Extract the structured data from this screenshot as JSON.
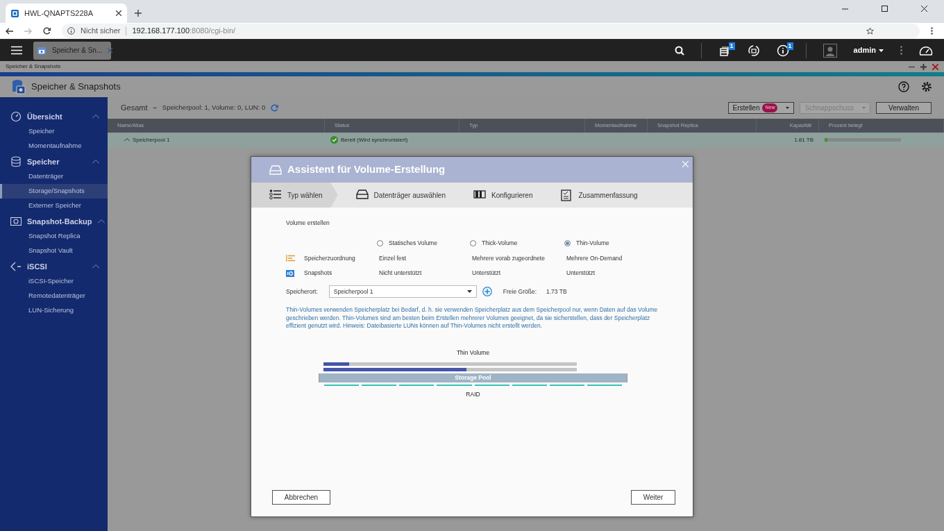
{
  "browser": {
    "tab_title": "HWL-QNAPTS228A",
    "security": "Nicht sicher",
    "url_host": "192.168.177.100",
    "url_rest": ":8080/cgi-bin/"
  },
  "app_bar": {
    "app_tab": "Speicher & Sn...",
    "toolbar_icons": [
      {
        "kind": "tasks",
        "badge": "1"
      },
      {
        "kind": "sync"
      },
      {
        "kind": "info",
        "badge": "1"
      }
    ],
    "user": "admin"
  },
  "window": {
    "caption": "Speicher & Snapshots",
    "title": "Speicher & Snapshots"
  },
  "sidebar": {
    "groups": [
      {
        "label": "Übersicht",
        "kind": "gauge",
        "expanded": true,
        "children": [
          {
            "label": "Speicher",
            "selected": false
          },
          {
            "label": "Momentaufnahme",
            "selected": false
          }
        ]
      },
      {
        "label": "Speicher",
        "kind": "database",
        "expanded": true,
        "children": [
          {
            "label": "Datenträger",
            "selected": false
          },
          {
            "label": "Storage/Snapshots",
            "selected": true
          },
          {
            "label": "Externer Speicher",
            "selected": false
          }
        ]
      },
      {
        "label": "Snapshot-Backup",
        "kind": "camera",
        "expanded": true,
        "children": [
          {
            "label": "Snapshot Replica",
            "selected": false
          },
          {
            "label": "Snapshot Vault",
            "selected": false
          }
        ]
      },
      {
        "label": "iSCSI",
        "kind": "iscsi",
        "expanded": true,
        "children": [
          {
            "label": "iSCSI-Speicher",
            "selected": false
          },
          {
            "label": "Remotedatenträger",
            "selected": false
          },
          {
            "label": "LUN-Sicherung",
            "selected": false
          }
        ]
      }
    ]
  },
  "summary": {
    "title": "Gesamt",
    "dash": "–",
    "detail": "Speicherpool: 1, Volume: 0, LUN: 0"
  },
  "actions": [
    {
      "label": "Erstellen",
      "badge": "New",
      "dropdown": true,
      "disabled": false
    },
    {
      "label": "Schnappschuss",
      "dropdown": true,
      "disabled": true
    },
    {
      "label": "Verwalten",
      "dropdown": false,
      "disabled": false
    }
  ],
  "table": {
    "columns": [
      "Name/Alias",
      "Status",
      "Typ",
      "Momentaufnahme",
      "Snapshot Replica",
      "Kapazität",
      "Prozent belegt"
    ],
    "rows": [
      {
        "name": "Speicherpool 1",
        "expanded": true,
        "status": "Bereit (Wird synchronisiert)",
        "capacity": "1.81 TB",
        "level": 0.04
      }
    ]
  },
  "dialog": {
    "title": "Assistent für Volume-Erstellung",
    "steps": [
      {
        "label": "Typ wählen",
        "kind": "list",
        "selected": true
      },
      {
        "label": "Datenträger auswählen",
        "kind": "drive",
        "selected": false
      },
      {
        "label": "Konfigurieren",
        "kind": "config",
        "selected": false
      },
      {
        "label": "Zusammenfassung",
        "kind": "clipboard",
        "selected": false
      }
    ],
    "section": "Volume erstellen",
    "options": [
      {
        "label": "Statisches Volume",
        "selected": false
      },
      {
        "label": "Thick-Volume",
        "selected": false
      },
      {
        "label": "Thin-Volume",
        "selected": true
      }
    ],
    "features": [
      {
        "kind": "allocation",
        "label": "Speicherzuordnung",
        "values": [
          "Einzel fest",
          "Mehrere vorab zugeordnete",
          "Mehrere On-Demand"
        ]
      },
      {
        "kind": "snapshot",
        "label": "Snapshots",
        "values": [
          "Nicht unterstützt",
          "Unterstützt",
          "Unterstützt"
        ]
      }
    ],
    "location": {
      "label": "Speicherort:",
      "value": "Speicherpool 1",
      "free_label": "Freie Größe:",
      "free_value": "1.73 TB"
    },
    "description": "Thin-Volumes verwenden Speicherplatz bei Bedarf, d. h. sie verwenden Speicherplatz aus dem Speicherpool nur, wenn Daten auf das Volume geschrieben werden. Thin-Volumes sind am besten beim Erstellen mehrerer Volumes geeignet, da sie sicherstellen, dass der Speicherplatz effizient genutzt wird. Hinweis: Dateibasierte LUNs können auf Thin-Volumes nicht erstellt werden.",
    "diagram": {
      "title": "Thin Volume",
      "volumes": [
        {
          "level": 0.1
        },
        {
          "level": 0.565
        }
      ],
      "pool_label": "Storage Pool",
      "raid_label": "RAID"
    },
    "cancel": "Abbrechen",
    "next": "Weiter"
  }
}
